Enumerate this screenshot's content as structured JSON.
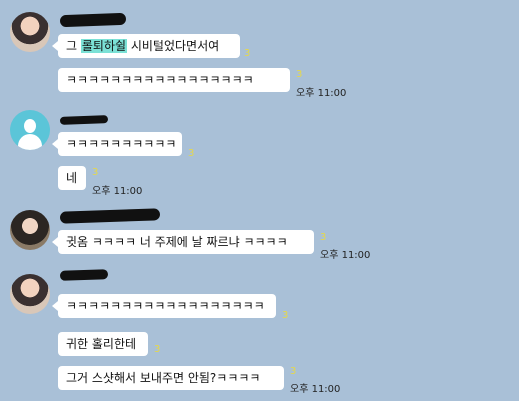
{
  "messages": [
    {
      "text_before": "그 ",
      "highlight": "롤퇴하쉴",
      "text_after": " 시비털었다면서여",
      "unread": "3"
    },
    {
      "text": "ㅋㅋㅋㅋㅋㅋㅋㅋㅋㅋㅋㅋㅋㅋㅋㅋㅋ",
      "unread": "3",
      "time": "오후 11:00"
    },
    {
      "text": "ㅋㅋㅋㅋㅋㅋㅋㅋㅋㅋ",
      "unread": "3"
    },
    {
      "text": "네",
      "unread": "3",
      "time": "오후 11:00"
    },
    {
      "text": "귓옴 ㅋㅋㅋㅋ 너 주제에 날 짜르냐 ㅋㅋㅋㅋ",
      "unread": "3",
      "time": "오후 11:00"
    },
    {
      "text": "ㅋㅋㅋㅋㅋㅋㅋㅋㅋㅋㅋㅋㅋㅋㅋㅋㅋㅋ",
      "unread": "3"
    },
    {
      "text": "귀한 홀리한테",
      "unread": "3"
    },
    {
      "text": "그거 스샷해서 보내주면 안됨?ㅋㅋㅋㅋ",
      "unread": "3",
      "time": "오후 11:00"
    }
  ]
}
